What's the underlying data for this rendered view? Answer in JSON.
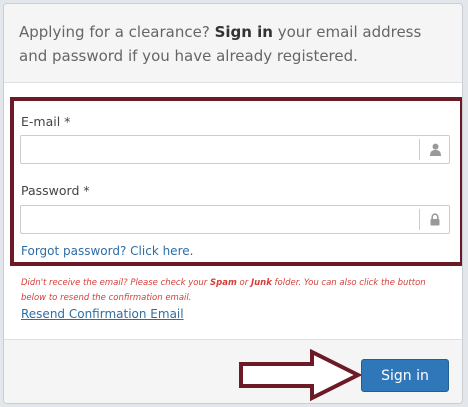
{
  "header": {
    "text_before": "Applying for a clearance? ",
    "text_bold": "Sign in",
    "text_after": " your email address and password if you have already registered."
  },
  "form": {
    "email_label": "E-mail *",
    "email_value": "",
    "password_label": "Password *",
    "password_value": "",
    "forgot_link": "Forgot password? Click here."
  },
  "notice": {
    "part1": "Didn't receive the email? Please check your ",
    "spam": "Spam",
    "part2": " or ",
    "junk": "Junk",
    "part3": " folder. You can also click the button below to resend the confirmation email."
  },
  "resend_link": "Resend Confirmation Email",
  "footer": {
    "signin_button": "Sign in"
  },
  "colors": {
    "highlight_border": "#6b1a26",
    "primary_button": "#2f77b8",
    "link": "#2e6ea6",
    "notice_text": "#d43f3a"
  },
  "icons": {
    "email_addon": "user-icon",
    "password_addon": "lock-icon",
    "pointer": "arrow-right-icon"
  }
}
